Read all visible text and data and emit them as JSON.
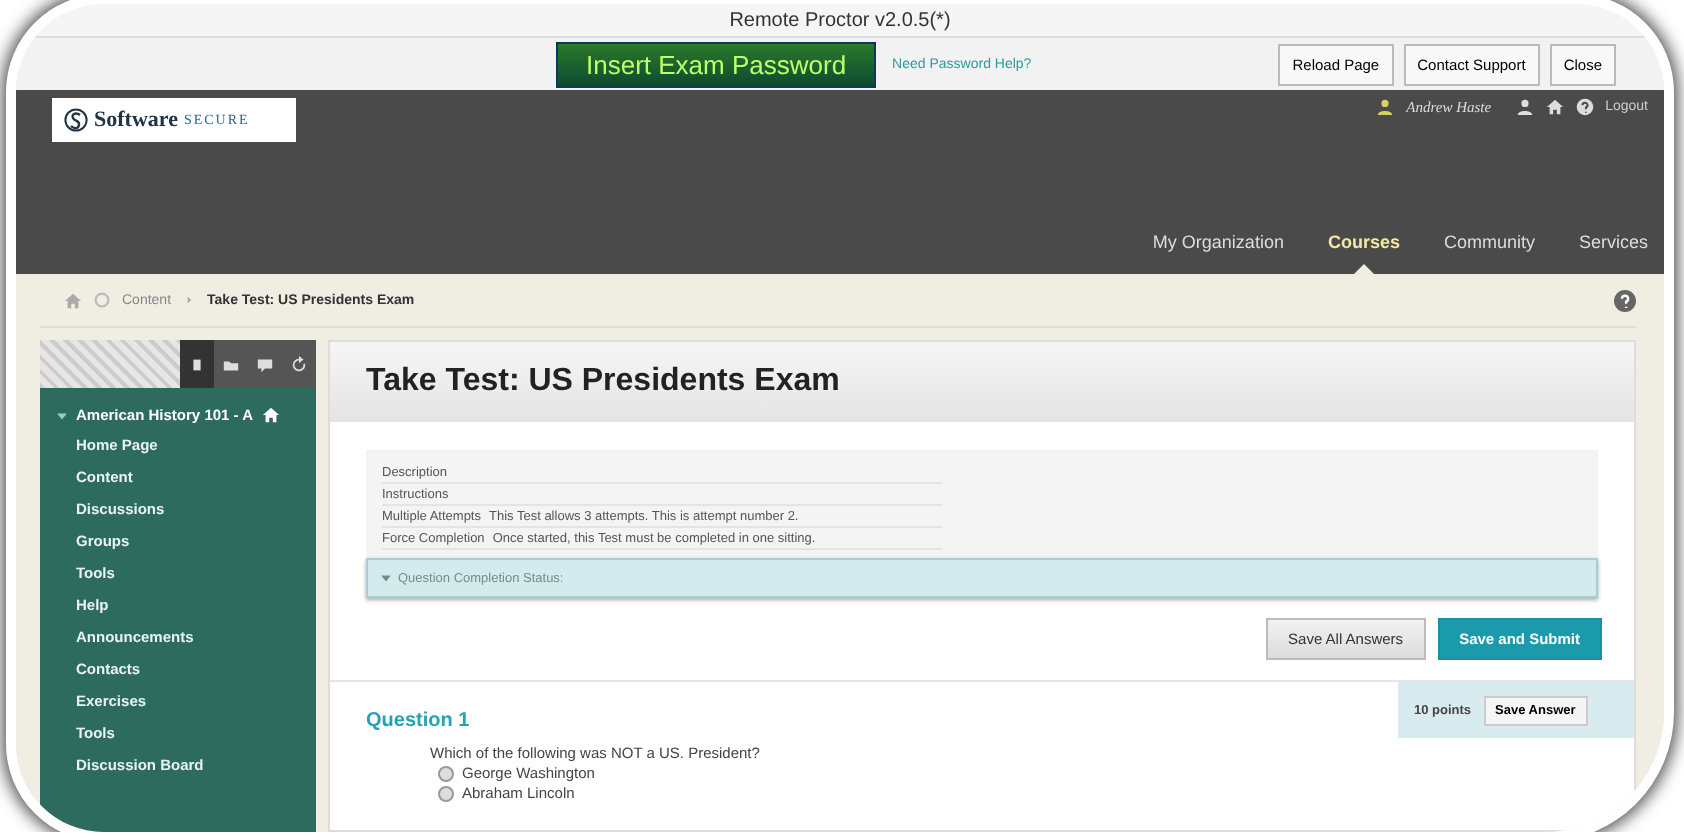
{
  "window": {
    "title": "Remote Proctor v2.0.5(*)"
  },
  "toolbar": {
    "password_button": "Insert Exam Password",
    "help_link": "Need Password Help?",
    "buttons": [
      "Reload Page",
      "Contact Support",
      "Close"
    ]
  },
  "header": {
    "logo": {
      "word": "Software",
      "accent": "SECURE"
    },
    "user": "Andrew Haste",
    "logout": "Logout",
    "nav": [
      {
        "label": "My Organization",
        "selected": false
      },
      {
        "label": "Courses",
        "selected": true
      },
      {
        "label": "Community",
        "selected": false
      },
      {
        "label": "Services",
        "selected": false
      }
    ]
  },
  "breadcrumb": [
    "Content",
    "Take Test: US Presidents Exam"
  ],
  "sidebar": {
    "course": "American History 101 - A",
    "items": [
      "Home Page",
      "Content",
      "Discussions",
      "Groups",
      "Tools",
      "Help",
      "Announcements",
      "Contacts",
      "Exercises",
      "Tools",
      "Discussion Board"
    ]
  },
  "content": {
    "title": "Take Test: US Presidents Exam",
    "details": [
      {
        "label": "Description"
      },
      {
        "label": "Instructions"
      },
      {
        "label": "Multiple Attempts",
        "value": "This Test allows 3 attempts. This is attempt number 2."
      },
      {
        "label": "Force Completion",
        "value": "Once started, this Test must be completed in one sitting."
      }
    ],
    "completion_status": "Question Completion Status:",
    "buttons": [
      {
        "label": "Save All Answers",
        "kind": "secondary"
      },
      {
        "label": "Save and Submit",
        "kind": "primary"
      }
    ],
    "question": {
      "title": "Question 1",
      "points": "10 points",
      "save": "Save Answer",
      "prompt": "Which of the following was NOT a US. President?",
      "options": [
        {
          "label": "George Washington",
          "selected": false
        },
        {
          "label": "Abraham Lincoln",
          "selected": false
        }
      ]
    }
  }
}
